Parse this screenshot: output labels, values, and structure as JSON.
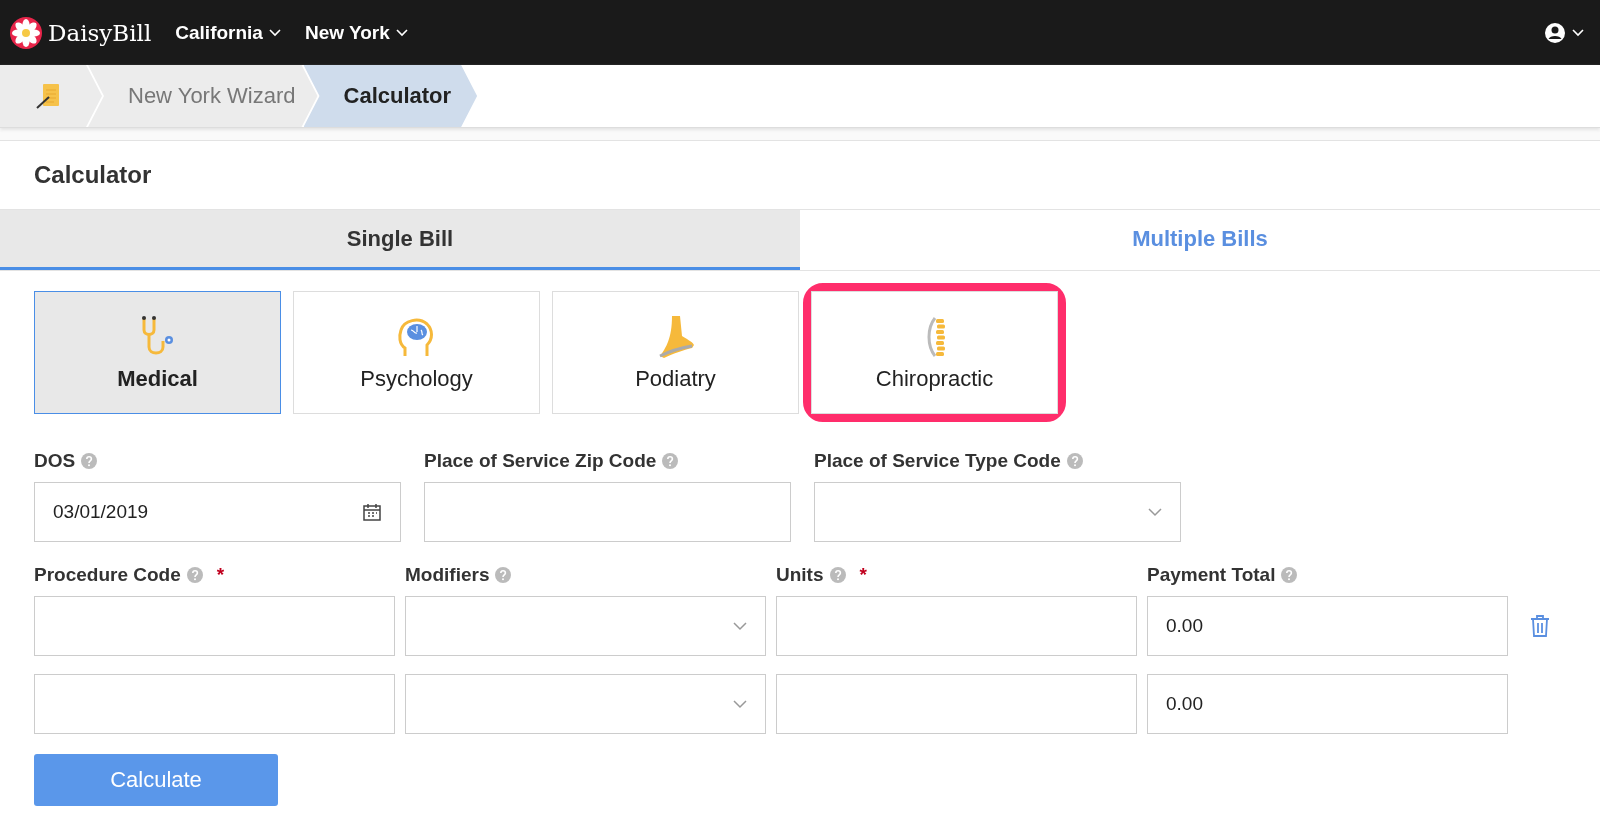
{
  "navbar": {
    "brand": "DaisyBill",
    "menus": [
      {
        "label": "California"
      },
      {
        "label": "New York"
      }
    ]
  },
  "breadcrumb": [
    {
      "label": "New York Wizard",
      "selected": false
    },
    {
      "label": "Calculator",
      "selected": true
    }
  ],
  "section_title": "Calculator",
  "tabs": [
    {
      "label": "Single Bill",
      "selected": true
    },
    {
      "label": "Multiple Bills",
      "selected": false
    }
  ],
  "specialties": [
    {
      "label": "Medical",
      "kind": "stethoscope",
      "selected": true,
      "highlighted": false
    },
    {
      "label": "Psychology",
      "kind": "brain",
      "selected": false,
      "highlighted": false
    },
    {
      "label": "Podiatry",
      "kind": "foot",
      "selected": false,
      "highlighted": false
    },
    {
      "label": "Chiropractic",
      "kind": "spine",
      "selected": false,
      "highlighted": true
    }
  ],
  "top_fields": [
    {
      "label": "DOS",
      "kind": "date",
      "value": "03/01/2019"
    },
    {
      "label": "Place of Service Zip Code",
      "kind": "text"
    },
    {
      "label": "Place of Service Type Code",
      "kind": "select"
    }
  ],
  "line_columns": [
    {
      "label": "Procedure Code",
      "required": true
    },
    {
      "label": "Modifiers",
      "required": false
    },
    {
      "label": "Units",
      "required": true
    },
    {
      "label": "Payment Total",
      "required": false
    }
  ],
  "required_mark": "*",
  "lines": [
    {
      "payment_total": "0.00",
      "deletable": true
    },
    {
      "payment_total": "0.00",
      "deletable": false
    }
  ],
  "calculate_button": "Calculate"
}
